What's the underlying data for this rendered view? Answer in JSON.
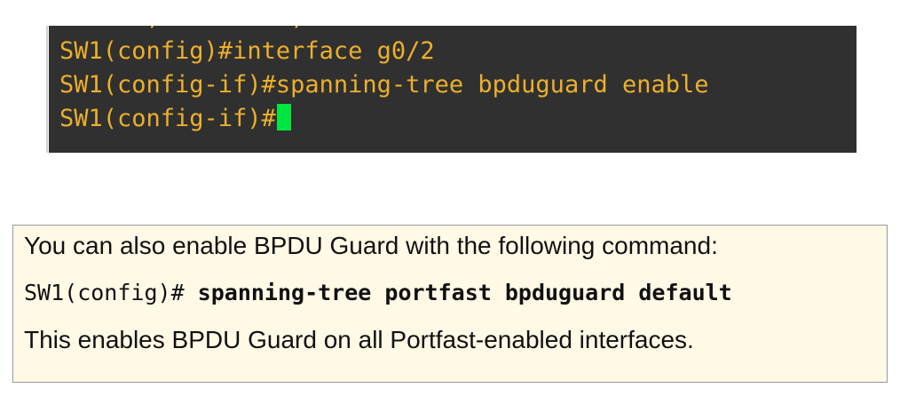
{
  "terminal": {
    "clipped_text": "      ,         ,",
    "lines": [
      "SW1(config)#interface g0/2",
      "SW1(config-if)#spanning-tree bpduguard enable",
      "SW1(config-if)#"
    ],
    "text_color": "#ecaf2d",
    "background": "#303030",
    "cursor_color": "#00e640"
  },
  "note": {
    "intro": "You can also enable BPDU Guard with the following command:",
    "command_prompt": "SW1(config)# ",
    "command_bold": "spanning-tree portfast bpduguard default",
    "explanation": "This enables BPDU Guard on all Portfast-enabled interfaces.",
    "background": "#fff9e6"
  }
}
